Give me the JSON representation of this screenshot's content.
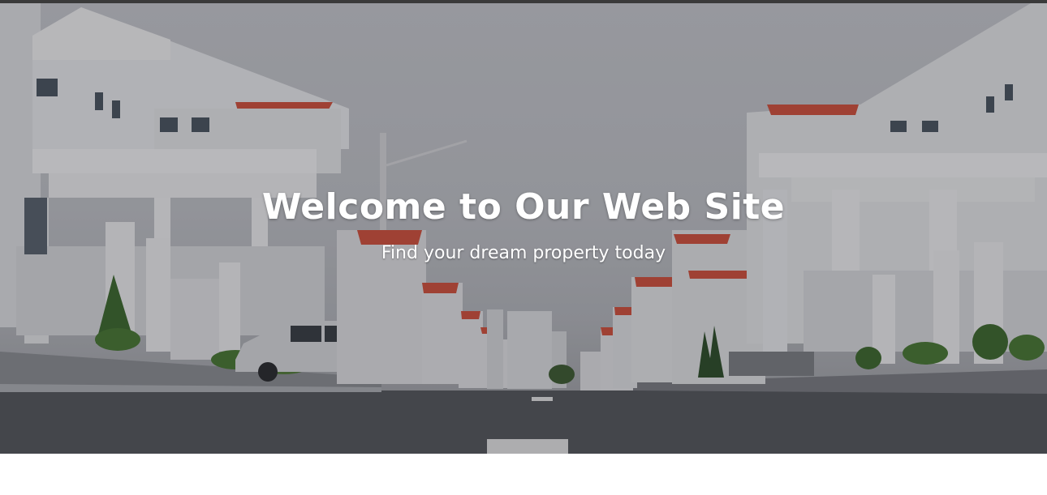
{
  "hero": {
    "title": "Welcome to Our Web Site",
    "subtitle": "Find your dream property today",
    "background_image": "street-of-white-villas-photo"
  },
  "colors": {
    "topbar": "#3a3a3a",
    "text": "#ffffff",
    "roof": "#d4533d",
    "page_bg": "#ffffff"
  }
}
